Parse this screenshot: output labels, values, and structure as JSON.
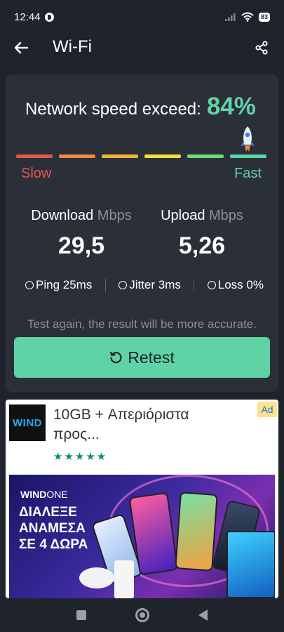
{
  "status_bar": {
    "time": "12:44",
    "battery": "83"
  },
  "app_bar": {
    "title": "Wi-Fi"
  },
  "speed": {
    "exceed_label": "Network speed exceed:",
    "exceed_value": "84%",
    "slow_label": "Slow",
    "fast_label": "Fast",
    "bar_colors": [
      "#e2574c",
      "#ef8a45",
      "#f3b33d",
      "#f2de3c",
      "#6fdc7a",
      "#5fd3a6"
    ]
  },
  "download": {
    "label": "Download",
    "unit": "Mbps",
    "value": "29,5"
  },
  "upload": {
    "label": "Upload",
    "unit": "Mbps",
    "value": "5,26"
  },
  "stats": {
    "ping": "Ping 25ms",
    "jitter": "Jitter 3ms",
    "loss": "Loss 0%"
  },
  "hint": "Test again, the result will be more accurate.",
  "retest_label": "Retest",
  "ad": {
    "logo_text": "WIND",
    "title": "10GB + Απεριόριστα προς...",
    "stars": "★★★★★",
    "badge": "Ad",
    "banner_brand": "WIND",
    "banner_brand_suffix": "ONE",
    "banner_text": "ΔΙΑΛΕΞΕ ΑΝΑΜΕΣΑ ΣΕ 4 ΔΩΡΑ"
  },
  "colors": {
    "accent": "#5fd3a6",
    "background": "#1f232b",
    "card": "#2b2f37"
  }
}
